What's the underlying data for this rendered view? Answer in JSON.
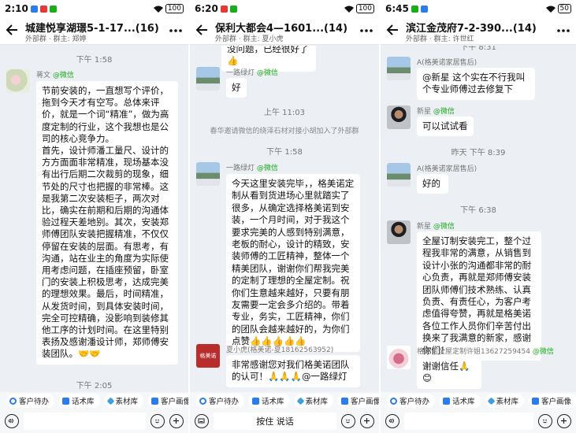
{
  "panels": [
    {
      "status": {
        "time": "2:10",
        "battery": "100"
      },
      "header": {
        "title": "城建悦享湖璟5-1-17...(16)",
        "subtitle": "外部群 · 群主: 郑婷"
      },
      "timestamps": [
        "下午 1:58",
        "下午 2:05"
      ],
      "message": {
        "sender": "蒋文",
        "source": "@微信",
        "text": "节前安装的，一直想写个评价，拖到今天才有空写。总体来评价，就是一个词“精准”，做为高度定制的行业，这个我想也是公司的核心竞争力。\n首先，设计师潘工量尺、设计的方方面面非常精准，现场基本没有出行后期二次裁剪的现象，细节处的尺寸也把握的非常棒。这是我第二次安装柜子，两次对比，确实在前期和后期的沟通体验过程天差地别。其次，安装郑师傅团队安装把握精准，不仅仅停留在安装的层面。有思考，有沟通，站在业主的角度为实际使用考虑问题，在插座预留，卧室门的安装上积极思考，达成完美的理想效果。最后，时间精准，从发货时间，到具体安装时间，完全可控精确，没影响到装修其他工序的计划时间。在这里特别表扬及感谢潘设计师，郑师傅安装团队。🤝🤝"
      },
      "toolbar": [
        "客户待办",
        "话术库",
        "素材库",
        "客户画像"
      ],
      "input": ""
    },
    {
      "status": {
        "time": "6:20",
        "battery": "100"
      },
      "header": {
        "title": "保利大都会4—1601...(14)",
        "subtitle": "外部群 · 群主: 夏小虎"
      },
      "top_text": "没问题，已经很好了👍",
      "msg1": {
        "sender": "一路绿灯",
        "source": "@微信",
        "text": "好"
      },
      "timestamps": [
        "上午 11:03",
        "下午 1:58"
      ],
      "system": "春华邀请微信的绕泽石材对接小胡加入了外部群",
      "msg2": {
        "sender": "一路绿灯",
        "source": "@微信",
        "text": "今天这里安装完毕，，格美诺定制从看到货进场心里就踏实了很多，从确定选择格美诺到安装，一个月时间，对于我这个要求完美的人感到特别满意，老板的耐心，设计的精致，安装师傅的工匠精神，整体一个精美团队，谢谢你们帮我完美的定制了理想的全屋定制。祝你们生意越来越好，只要有朋友需要一定会多介绍的。带着专业，务实，工匠精神，你们的团队会越来越好的，为你们点赞👍👍👍👍👍"
      },
      "msg3": {
        "sender": "夏小虎(格美诺-夏18162563952)",
        "avatar_text": "格美诺",
        "text": "非常感谢您对我们格美诺团队的认可！🙏🙏🙏@一路绿灯"
      },
      "toolbar": [
        "客户待办",
        "话术库",
        "素材库",
        "客户画像"
      ],
      "input": "按住 说话"
    },
    {
      "status": {
        "time": "6:45",
        "battery": "50"
      },
      "header": {
        "title": "滨江金茂府7-2-390...(14)",
        "subtitle": "外部群 · 群主: 许世红"
      },
      "top_ts": "下午 8:31",
      "msg1": {
        "sender": "A(格美诺家居售后)",
        "text": "@新星 这个实在不行我叫个专业师傅过去修复下"
      },
      "msg2": {
        "sender": "新星",
        "source": "@微信",
        "text": "可以试试看"
      },
      "timestamps": [
        "昨天 下午 8:39",
        "下午 6:38"
      ],
      "msg3": {
        "sender": "A(格美诺家居售后)",
        "text": "好的"
      },
      "msg4": {
        "sender": "新星",
        "source": "@微信",
        "text": "全屋订制安装完工，整个过程我非常的满意，从销售到设计小张的沟通都非常的耐心负责，再就是郑师傅安装团队师傅们技术熟练、认真负责、有责任心，为客户考虑值得夸赞，再就是格美诺各位工作人员你们辛苦付出换来了我满意的新家，感谢你们！"
      },
      "msg5": {
        "sender": "格美诺全屋定制许姐13627259454",
        "source": "@微信",
        "text": "谢谢信任🙏😊"
      },
      "toolbar": [
        "客户待办",
        "话术库",
        "素材库",
        "客户画像"
      ],
      "input": ""
    }
  ]
}
